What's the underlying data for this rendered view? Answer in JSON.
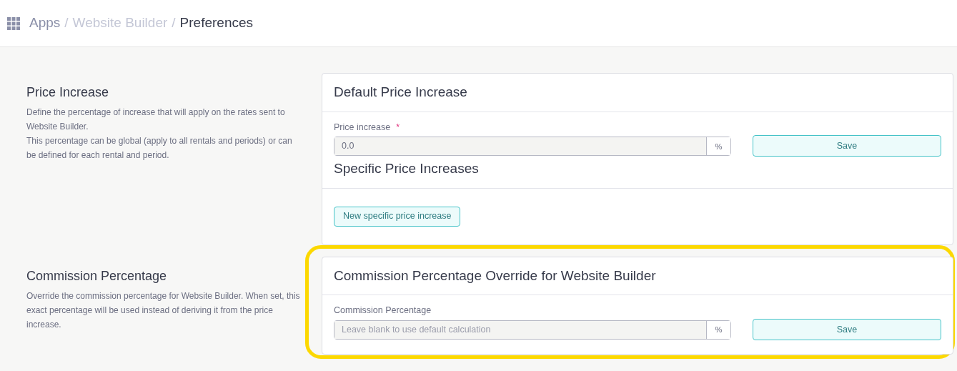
{
  "breadcrumb": [
    {
      "kind": "link",
      "label": "Apps"
    },
    {
      "kind": "separator",
      "label": "/"
    },
    {
      "kind": "link",
      "label": "Website Builder"
    },
    {
      "kind": "separator",
      "label": "/"
    },
    {
      "kind": "current",
      "label": "Preferences"
    }
  ],
  "sections": [
    {
      "title": "Price Increase",
      "highlighted": false,
      "description": [
        "Define the percentage of increase that will apply on the rates sent to Website Builder.",
        "This percentage can be global (apply to all rentals and periods) or can be defined for each rental and period."
      ],
      "groups": [
        {
          "heading": "Default Price Increase",
          "field": {
            "label": "Price increase",
            "required_mark": "*",
            "value": "0.0",
            "suffix": "%"
          },
          "save": "Save"
        },
        {
          "heading": "Specific Price Increases",
          "button": "New specific price increase"
        }
      ]
    },
    {
      "title": "Commission Percentage",
      "highlighted": true,
      "description": [
        "Override the commission percentage for Website Builder. When set, this exact percentage will be used instead of deriving it from the price increase."
      ],
      "groups": [
        {
          "heading": "Commission Percentage Override for Website Builder",
          "field": {
            "label": "Commission Percentage",
            "placeholder": "Leave blank to use default calculation",
            "suffix": "%"
          },
          "save": "Save"
        }
      ]
    }
  ]
}
